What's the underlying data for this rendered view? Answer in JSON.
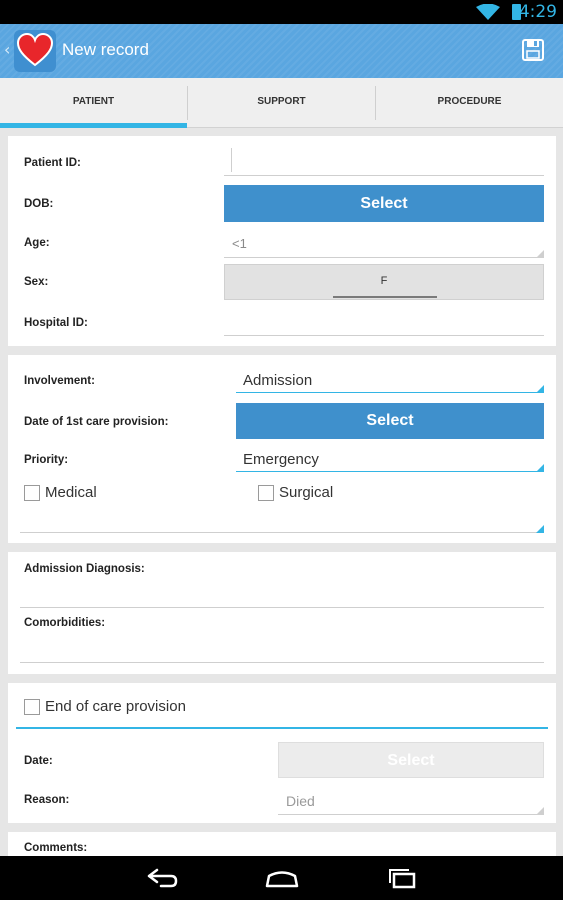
{
  "status": {
    "time": "4:29"
  },
  "app": {
    "title": "New record"
  },
  "tabs": [
    {
      "label": "PATIENT"
    },
    {
      "label": "SUPPORT"
    },
    {
      "label": "PROCEDURE"
    }
  ],
  "patient": {
    "patient_id_label": "Patient ID:",
    "patient_id_value": "",
    "dob_label": "DOB:",
    "dob_button": "Select",
    "age_label": "Age:",
    "age_value": "<1",
    "sex_label": "Sex:",
    "sex_value": "F",
    "hospital_id_label": "Hospital ID:",
    "hospital_id_value": ""
  },
  "care": {
    "involvement_label": "Involvement:",
    "involvement_value": "Admission",
    "first_care_label": "Date of 1st care provision:",
    "first_care_button": "Select",
    "priority_label": "Priority:",
    "priority_value": "Emergency",
    "medical_label": "Medical",
    "surgical_label": "Surgical"
  },
  "diagnosis": {
    "admission_label": "Admission Diagnosis:",
    "comorbidities_label": "Comorbidities:"
  },
  "end_of_care": {
    "checkbox_label": "End of care provision",
    "date_label": "Date:",
    "date_button": "Select",
    "reason_label": "Reason:",
    "reason_value": "Died"
  },
  "comments": {
    "label": "Comments:"
  },
  "colors": {
    "accent": "#33b5e5",
    "action_bar": "#5aa6e0",
    "button": "#3f90cc"
  }
}
